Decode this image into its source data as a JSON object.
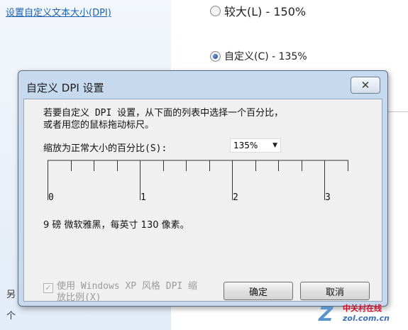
{
  "background": {
    "link": "设置自定义文本大小(DPI)",
    "left_snippet_1": "另",
    "left_snippet_2": "个",
    "radio_options": [
      {
        "label": "较大(L) - 150%",
        "selected": false
      },
      {
        "label": "自定义(C) - 135%",
        "selected": true
      }
    ]
  },
  "dialog": {
    "title": "自定义 DPI 设置",
    "close_glyph": "✕",
    "description": "若要自定义 DPI 设置，从下面的列表中选择一个百分比，\n或者用您的鼠标拖动标尺。",
    "scale_label": "缩放为正常大小的百分比(S):",
    "scale_value": "135%",
    "ruler_labels": [
      "0",
      "1",
      "2",
      "3"
    ],
    "sample_text": "9 磅 微软雅黑，每英寸 130 像素。",
    "xp_checkbox_label": "使用 Windows XP 风格 DPI 缩\n放比例(X)",
    "xp_checkbox_checked": true,
    "ok_label": "确定",
    "cancel_label": "取消"
  },
  "watermark": {
    "mark": "Z",
    "cn": "中关村在线",
    "en": "zol.com.cn"
  }
}
